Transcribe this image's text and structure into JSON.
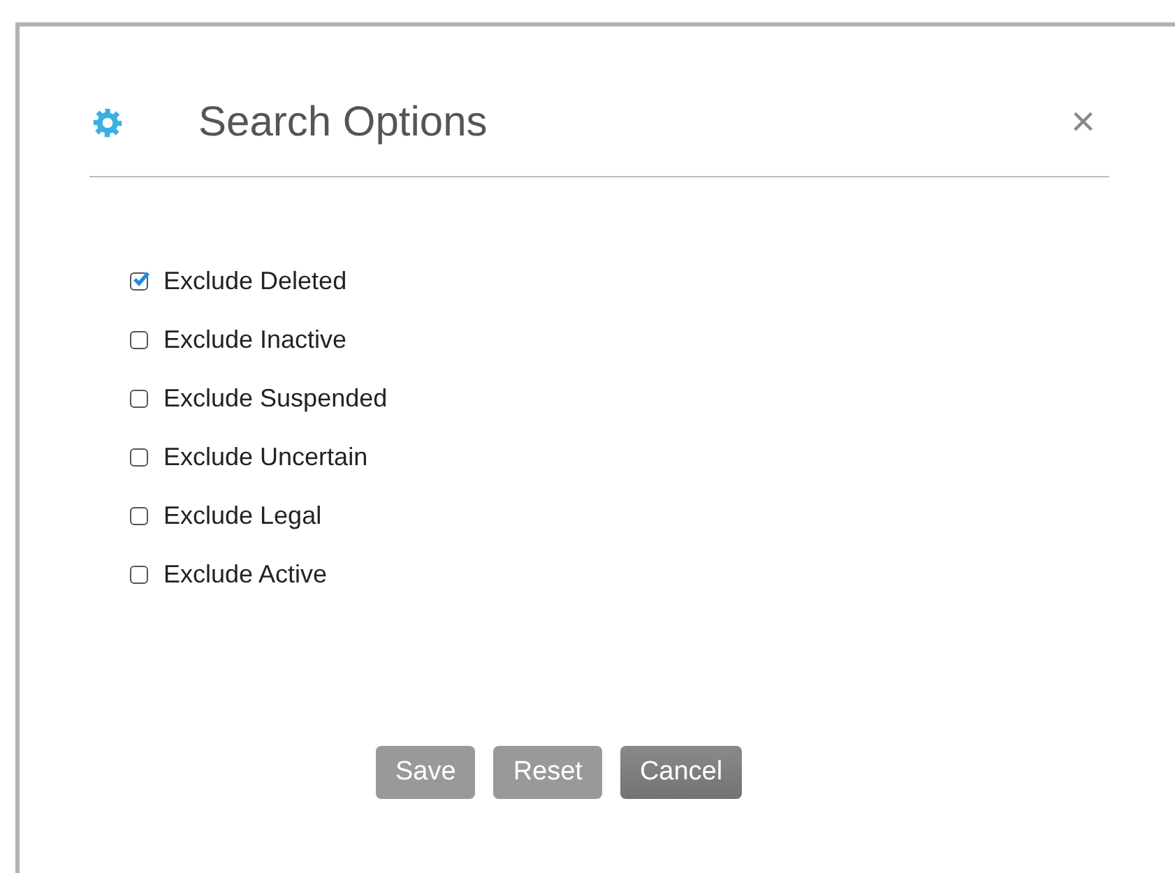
{
  "dialog": {
    "title": "Search Options",
    "close": "×"
  },
  "options": [
    {
      "label": "Exclude Deleted",
      "checked": true
    },
    {
      "label": "Exclude Inactive",
      "checked": false
    },
    {
      "label": "Exclude Suspended",
      "checked": false
    },
    {
      "label": "Exclude Uncertain",
      "checked": false
    },
    {
      "label": "Exclude Legal",
      "checked": false
    },
    {
      "label": "Exclude Active",
      "checked": false
    }
  ],
  "buttons": [
    {
      "label": "Save",
      "highlighted": false
    },
    {
      "label": "Reset",
      "highlighted": false
    },
    {
      "label": "Cancel",
      "highlighted": true
    }
  ]
}
